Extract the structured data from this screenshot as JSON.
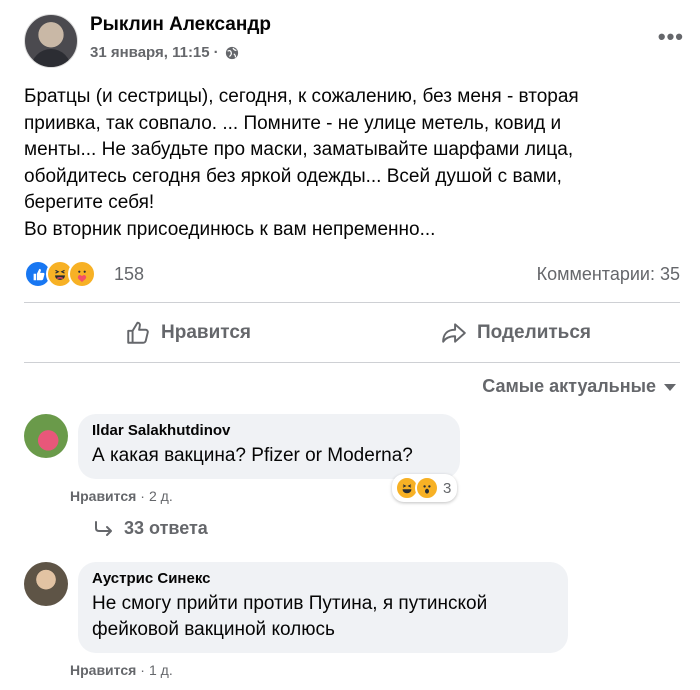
{
  "post": {
    "author": "Рыклин Александр",
    "date": "31 января, 11:15",
    "separator": "·",
    "more": "•••",
    "text": "Братцы (и сестрицы), сегодня, к сожалению, без меня - вторая\nприивка, так совпало. ... Помните - не улице метель, ковид и\nменты... Не забудьте про маски, заматывайте шарфами лица,\nобойдитесь сегодня без яркой одежды... Всей душой с вами,\nберегите себя!\nВо вторник присоединюсь к вам непременно..."
  },
  "reactions": {
    "count": "158",
    "comments": "Комментарии: 35",
    "icons": [
      "like-icon",
      "haha-icon",
      "care-icon"
    ]
  },
  "actions": {
    "like": "Нравится",
    "share": "Поделиться"
  },
  "sort": {
    "label": "Самые актуальные"
  },
  "comments": [
    {
      "name": "Ildar Salakhutdinov",
      "text": "А какая вакцина? Pfizer or Moderna?",
      "like": "Нравится",
      "sep": "·",
      "time": "2 д.",
      "reaction_count": "3",
      "replies": "33 ответа"
    },
    {
      "name": "Аустрис Синекс",
      "text": "Не смогу прийти против Путина, я путинской\nфейковой вакциной колюсь",
      "like": "Нравится",
      "sep": "·",
      "time": "1 д."
    }
  ],
  "colors": {
    "secondary_text": "#65676b",
    "bubble": "#f0f2f5",
    "like_blue": "#1877f2",
    "emoji_yellow": "#f7b125"
  }
}
